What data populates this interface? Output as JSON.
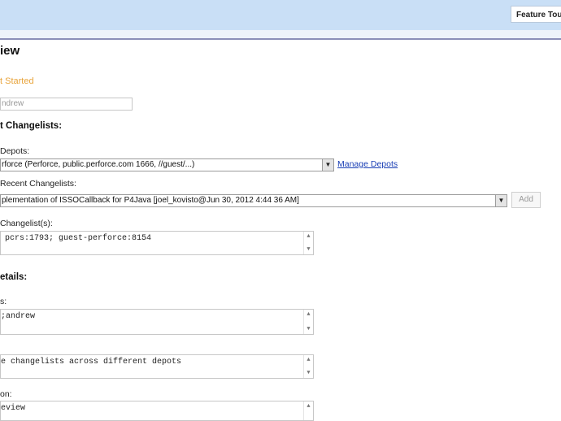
{
  "header": {
    "feature_tour_label": "Feature Tour"
  },
  "page": {
    "title": "iew",
    "get_started_link": "t Started"
  },
  "author_field": {
    "value": "ndrew"
  },
  "changelists_section": {
    "heading": "t Changelists:",
    "depots_label": "Depots:",
    "depot_selected": "rforce (Perforce, public.perforce.com 1666, //guest/...)",
    "manage_depots_link": "Manage Depots",
    "recent_label": "Recent Changelists:",
    "recent_selected": "plementation of ISSOCallback for P4Java [joel_kovisto@Jun 30, 2012 4:44 36 AM]",
    "add_button": "Add",
    "changelists_label": "Changelist(s):",
    "changelists_value": "pcrs:1793; guest-perforce:8154"
  },
  "details_section": {
    "heading": "etails:",
    "reviewers_label": "s:",
    "reviewers_value": ";andrew",
    "summary_value": "e changelists across different depots",
    "description_label": "on:",
    "description_value": "eview"
  },
  "icons": {
    "dropdown": "chevron-down-icon",
    "scroll_up": "scroll-up-arrow-icon",
    "scroll_down": "scroll-down-arrow-icon"
  },
  "colors": {
    "header_bg": "#c9dff6",
    "link_orange": "#e8a33a",
    "link_blue": "#1a3fb5"
  }
}
